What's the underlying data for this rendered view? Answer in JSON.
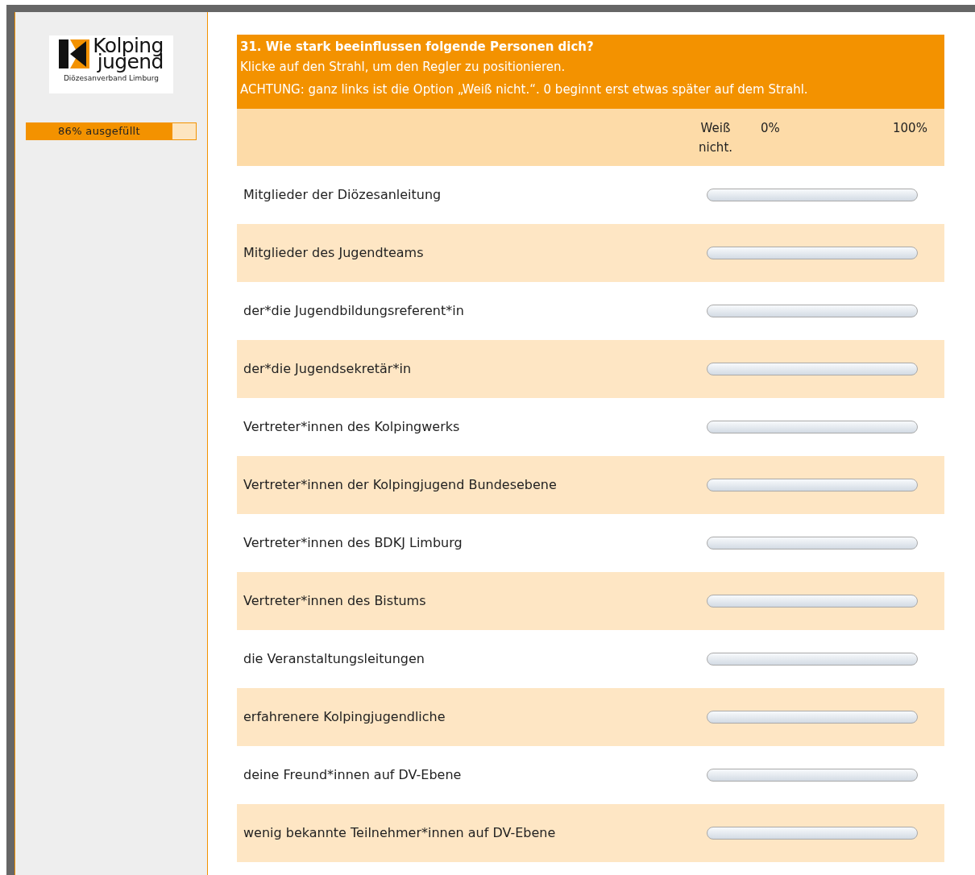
{
  "logo": {
    "name_line_1": "Kolping",
    "name_line_2": "jugend",
    "subtitle": "Diözesanverband Limburg"
  },
  "progress": {
    "label": "86% ausgefüllt",
    "level": 0.86
  },
  "question": {
    "title": "31. Wie stark beeinflussen folgende Personen dich?",
    "hint": "Klicke auf den Strahl, um den Regler zu positionieren.",
    "warning": "ACHTUNG: ganz links ist die Option „Weiß nicht.“. 0 beginnt erst etwas später auf dem Strahl."
  },
  "scale_labels": {
    "dont_know": "Weiß nicht.",
    "min": "0%",
    "max": "100%"
  },
  "rows": [
    {
      "label": "Mitglieder der Diözesanleitung"
    },
    {
      "label": "Mitglieder des Jugendteams"
    },
    {
      "label": "der*die Jugendbildungsreferent*in"
    },
    {
      "label": "der*die Jugendsekretär*in"
    },
    {
      "label": "Vertreter*innen des Kolpingwerks"
    },
    {
      "label": "Vertreter*innen der Kolpingjugend Bundesebene"
    },
    {
      "label": "Vertreter*innen des BDKJ Limburg"
    },
    {
      "label": "Vertreter*innen des Bistums"
    },
    {
      "label": "die Veranstaltungsleitungen"
    },
    {
      "label": "erfahrenere Kolpingjugendliche"
    },
    {
      "label": "deine Freund*innen auf DV-Ebene"
    },
    {
      "label": "wenig bekannte Teilnehmer*innen auf DV-Ebene"
    }
  ]
}
